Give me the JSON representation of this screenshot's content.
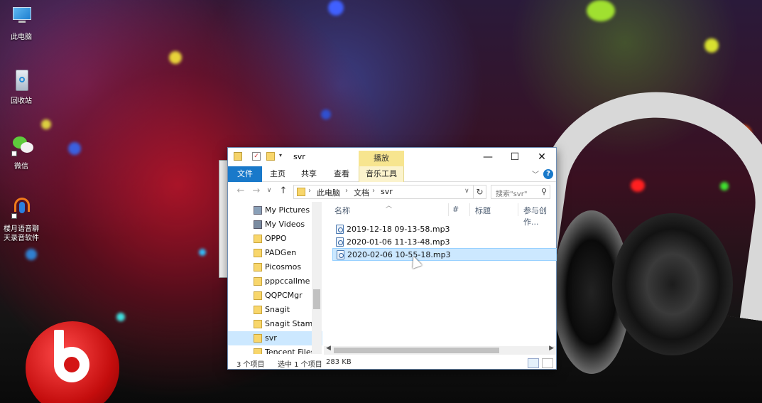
{
  "desktop": {
    "icons": [
      {
        "label": "此电脑"
      },
      {
        "label": "回收站"
      },
      {
        "label": "微信"
      },
      {
        "label": "楼月语音聊\n天录音软件"
      }
    ]
  },
  "window": {
    "title": "svr",
    "contextual_tab": "播放",
    "controls": {
      "minimize": "—",
      "maximize": "☐",
      "close": "✕"
    },
    "ribbon_tabs": [
      "文件",
      "主页",
      "共享",
      "查看",
      "音乐工具"
    ],
    "help_label": "?",
    "breadcrumb": [
      "此电脑",
      "文档",
      "svr"
    ],
    "search_placeholder": "搜索\"svr\"",
    "nav_items": [
      {
        "label": "My Pictures",
        "icon": "pictures-icon"
      },
      {
        "label": "My Videos",
        "icon": "videos-icon"
      },
      {
        "label": "OPPO",
        "icon": "folder-icon"
      },
      {
        "label": "PADGen",
        "icon": "folder-icon"
      },
      {
        "label": "Picosmos",
        "icon": "folder-icon"
      },
      {
        "label": "pppccallme",
        "icon": "folder-icon"
      },
      {
        "label": "QQPCMgr",
        "icon": "folder-icon"
      },
      {
        "label": "Snagit",
        "icon": "folder-icon"
      },
      {
        "label": "Snagit Stamp",
        "icon": "folder-icon"
      },
      {
        "label": "svr",
        "icon": "folder-icon",
        "selected": true
      },
      {
        "label": "Tencent Files",
        "icon": "folder-icon"
      }
    ],
    "columns": [
      "名称",
      "#",
      "标题",
      "参与创作..."
    ],
    "files": [
      {
        "name": "2019-12-18 09-13-58.mp3",
        "selected": false
      },
      {
        "name": "2020-01-06 11-13-48.mp3",
        "selected": false
      },
      {
        "name": "2020-02-06 10-55-18.mp3",
        "selected": true
      }
    ],
    "status": {
      "count": "3 个项目",
      "selected": "选中 1 个项目",
      "size": "283 KB"
    }
  },
  "colors": {
    "accent": "#1979ca",
    "selection": "#cce8ff",
    "contextual_tab": "#f7e58f"
  }
}
